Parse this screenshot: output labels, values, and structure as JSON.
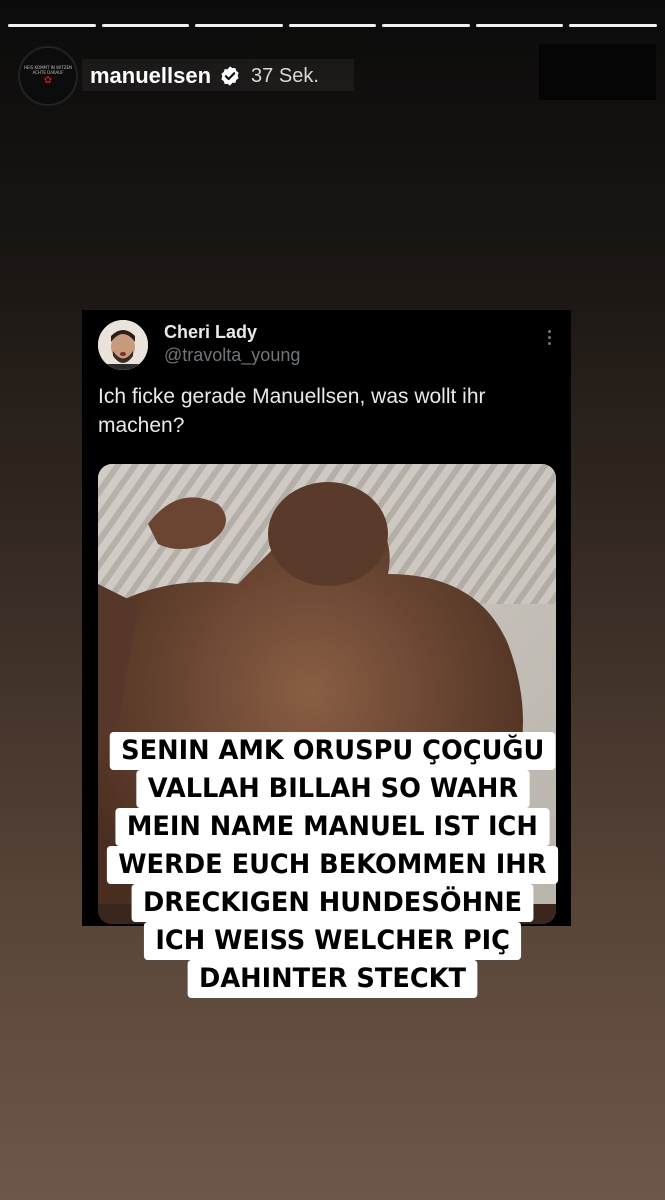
{
  "story": {
    "progress_total": 7,
    "progress_completed": 7
  },
  "header": {
    "username": "manuellsen",
    "time": "37 Sek.",
    "avatar_text": [
      "HEIS KOMMT IN WITZEN",
      "ACHTE DARAUF"
    ]
  },
  "tweet": {
    "display_name": "Cheri Lady",
    "handle": "@travolta_young",
    "text": "Ich ficke gerade Manuellsen, was wollt ihr machen?"
  },
  "caption": {
    "lines": [
      "SENIN AMK ORUSPU ÇOÇUĞU",
      "VALLAH BILLAH SO WAHR",
      "MEIN NAME MANUEL IST ICH",
      "WERDE EUCH BEKOMMEN IHR",
      "DRECKIGEN HUNDESÖHNE",
      "ICH WEISS WELCHER PIÇ",
      "DAHINTER STECKT"
    ]
  },
  "colors": {
    "play_button": "#1d9bf0",
    "verified_badge": "#ffffff",
    "caption_background": "#ffffff"
  }
}
